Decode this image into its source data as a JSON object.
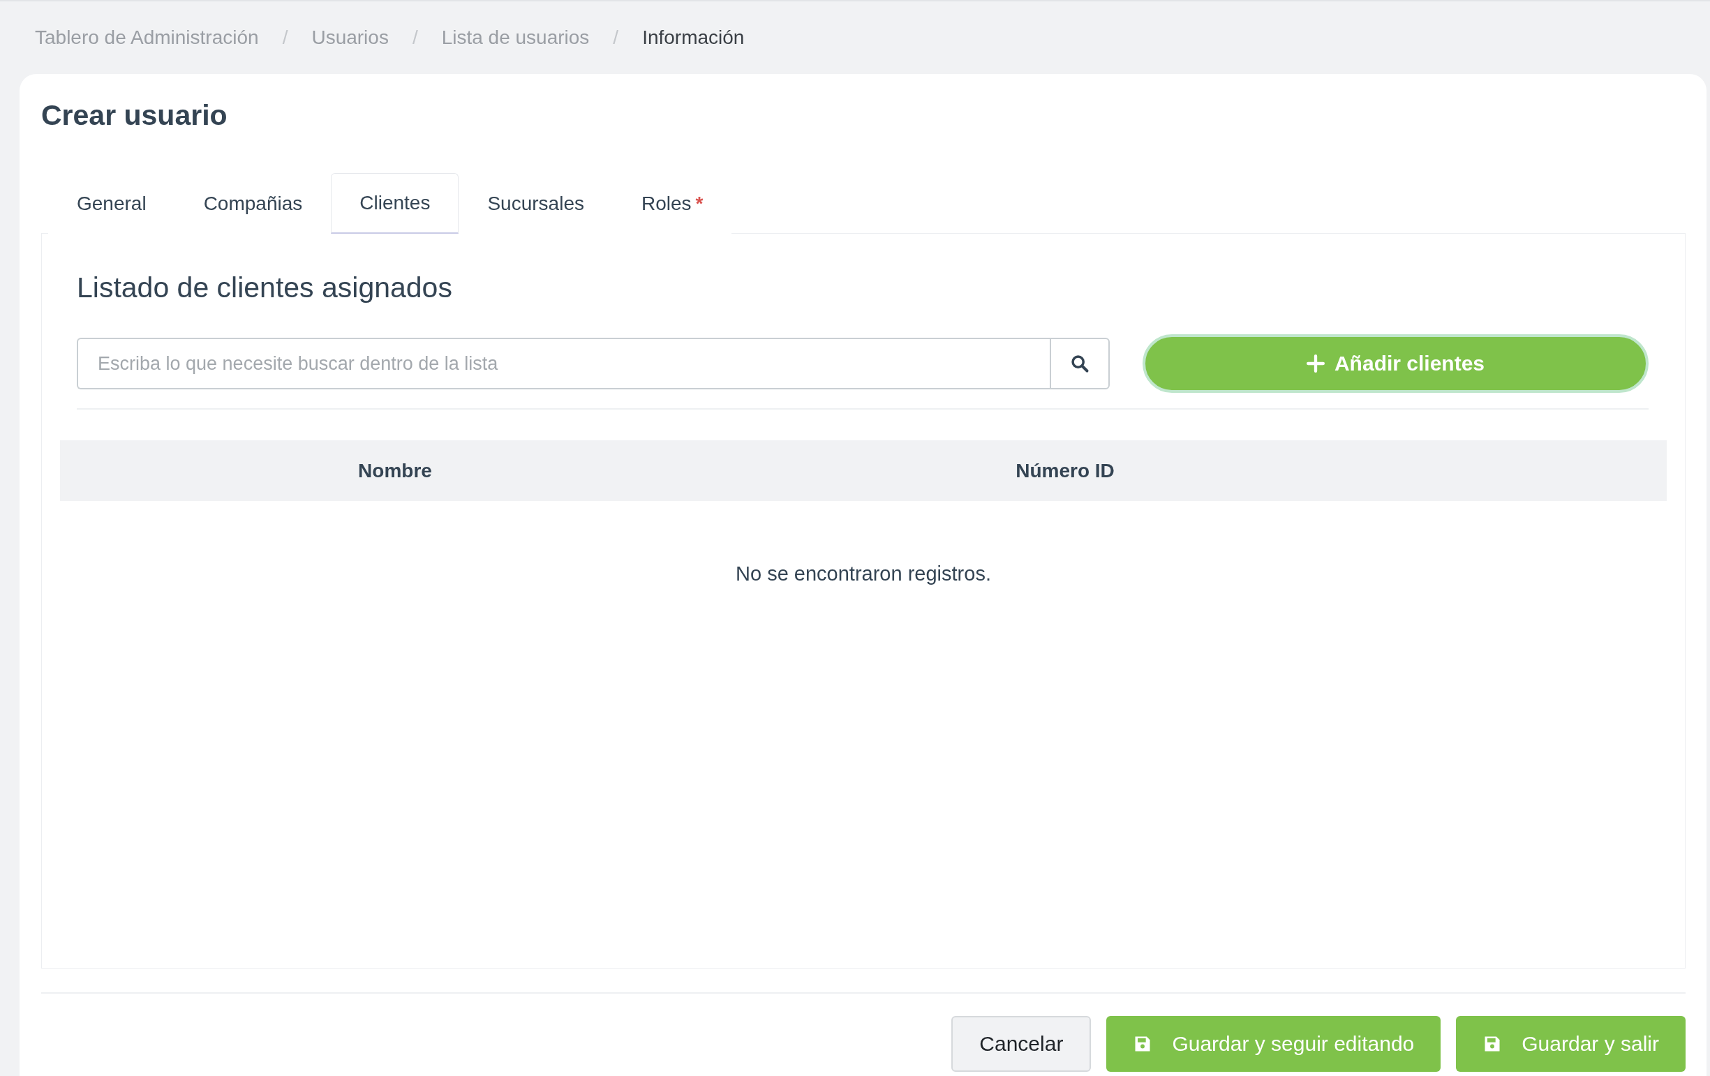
{
  "breadcrumb": [
    {
      "label": "Tablero de Administración",
      "current": false
    },
    {
      "label": "Usuarios",
      "current": false
    },
    {
      "label": "Lista de usuarios",
      "current": false
    },
    {
      "label": "Información",
      "current": true
    }
  ],
  "separator": "/",
  "title": "Crear usuario",
  "tabs": [
    {
      "label": "General",
      "selected": false,
      "required": false
    },
    {
      "label": "Compañias",
      "selected": false,
      "required": false
    },
    {
      "label": "Clientes",
      "selected": true,
      "required": false
    },
    {
      "label": "Sucursales",
      "selected": false,
      "required": false
    },
    {
      "label": "Roles",
      "selected": false,
      "required": true
    }
  ],
  "required_mark": "*",
  "panel": {
    "heading": "Listado de clientes asignados",
    "search": {
      "placeholder": "Escriba lo que necesite buscar dentro de la lista"
    },
    "add_button": "Añadir clientes",
    "table": {
      "columns": [
        "Nombre",
        "Número ID"
      ],
      "empty_message": "No se encontraron registros."
    }
  },
  "footer_buttons": [
    {
      "label": "Cancelar",
      "kind": "secondary"
    },
    {
      "label": "Guardar y seguir editando",
      "kind": "save"
    },
    {
      "label": "Guardar y salir",
      "kind": "save"
    }
  ]
}
